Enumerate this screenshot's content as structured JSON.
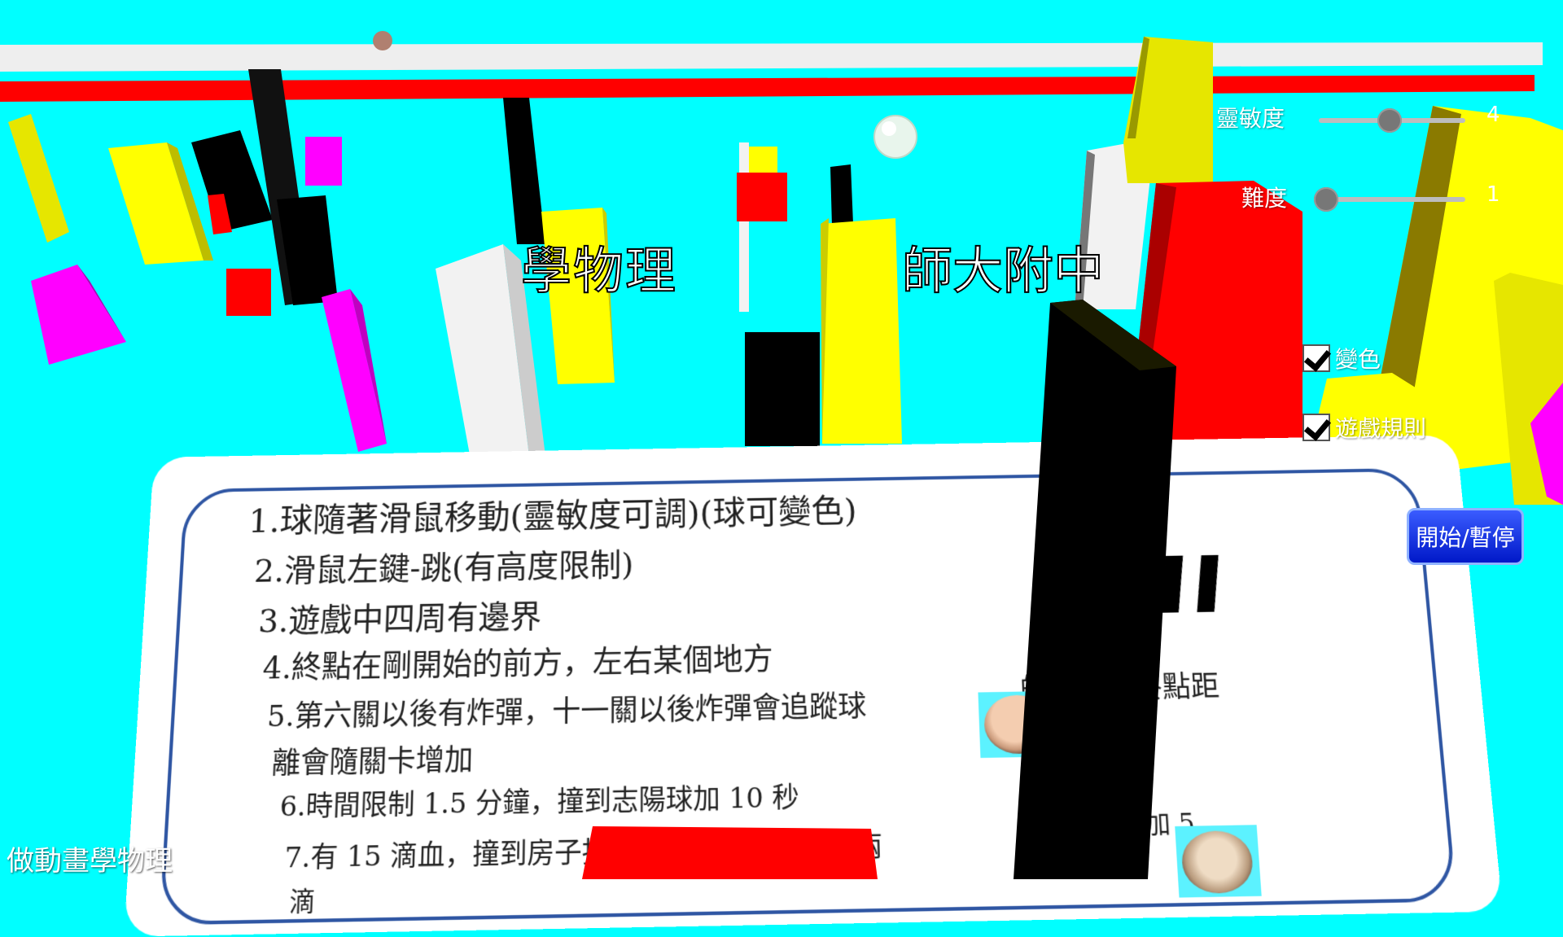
{
  "scene_colors": {
    "sky": "#00ffff",
    "yellow": "#ffff00",
    "red": "#ff0000",
    "magenta": "#ff00ff",
    "black": "#000000",
    "white": "#ffffff"
  },
  "scene_text": {
    "title_left": "學物理",
    "title_right": "師大附中"
  },
  "controls": {
    "sensitivity_label": "靈敏度",
    "sensitivity_value": "4",
    "sensitivity_level": 0.45,
    "difficulty_label": "難度",
    "difficulty_value": "1",
    "difficulty_level": 0.0,
    "color_change_label": "變色",
    "color_change_checked": true,
    "rules_label": "遊戲規則",
    "rules_checked": true,
    "start_pause_label": "開始/暫停"
  },
  "rules": {
    "r1": "1.球隨著滑鼠移動(靈敏度可調)(球可變色)",
    "r2": "2.滑鼠左鍵-跳(有高度限制)",
    "r3": "3.遊戲中四周有邊界",
    "r4": "4.終點在剛開始的前方，左右某個地方",
    "r5a": "5.第六關以後有炸彈，十一關以後炸彈會追蹤球",
    "r5b": "的濃度和終點距",
    "r5c": "離會隨關卡增加",
    "r6": "6.時間限制 1.5 分鐘，撞到志陽球加 10 秒",
    "r7a": "7.有 15 滴血，撞到房子扣一滴，被炸彈炸到扣兩",
    "r7b": "撞到阿寶球加 5",
    "r7c": "滴"
  },
  "footer": {
    "label": "做動畫學物理"
  }
}
